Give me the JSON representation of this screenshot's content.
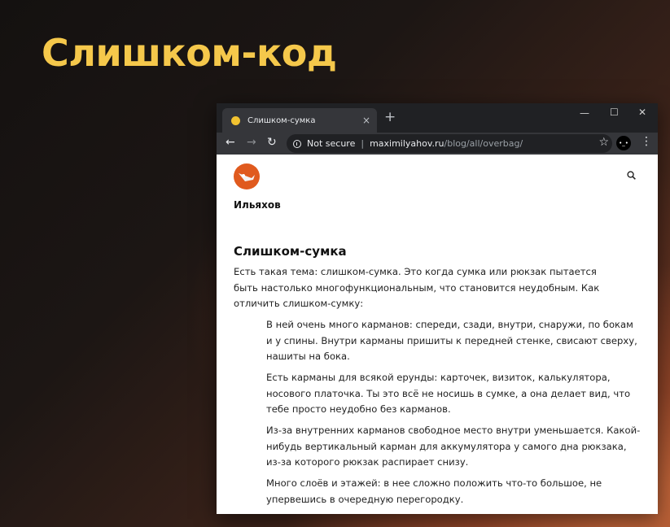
{
  "slide": {
    "title": "Слишком-код"
  },
  "browser": {
    "tab": {
      "title": "Слишком-сумка",
      "close": "×"
    },
    "new_tab": "+",
    "window_controls": {
      "minimize": "—",
      "maximize": "☐",
      "close": "✕"
    },
    "nav": {
      "back": "←",
      "forward": "→",
      "reload": "↻"
    },
    "address": {
      "security": "Not secure",
      "separator": "|",
      "host": "maximilyahov.ru",
      "path": "/blog/all/overbag/"
    },
    "star": "☆",
    "menu": "⋮",
    "profile": "•_•"
  },
  "page": {
    "author": "Ильяхов",
    "post_title": "Слишком-сумка",
    "intro": "Есть такая тема: слишком-сумка. Это когда сумка или рюкзак пытается быть настолько многофункциональным, что становится неудобным. Как отличить слишком-сумку:",
    "bullets": [
      "В ней очень много карманов: спереди, сзади, внутри, снаружи, по бокам и у спины. Внутри карманы пришиты к передней стенке, свисают сверху, нашиты на бока.",
      "Есть карманы для всякой ерунды: карточек, визиток, калькулятора, носового платочка. Ты это всё не носишь в сумке, а она делает вид, что тебе просто неудобно без карманов.",
      "Из-за внутренних карманов свободное место внутри уменьшается. Какой-нибудь вертикальный карман для аккумулятора у самого дна рюкзака, из-за которого рюкзак распирает снизу.",
      "Много слоёв и этажей: в нее сложно положить что-то большое, не упервешись в очередную перегородку."
    ]
  },
  "colors": {
    "title": "#f5c84b",
    "avatar": "#e05a1e",
    "favicon": "#f2c230"
  },
  "icons": [
    "search-icon",
    "info-icon",
    "star-icon",
    "menu-icon",
    "back-icon",
    "forward-icon",
    "reload-icon"
  ]
}
